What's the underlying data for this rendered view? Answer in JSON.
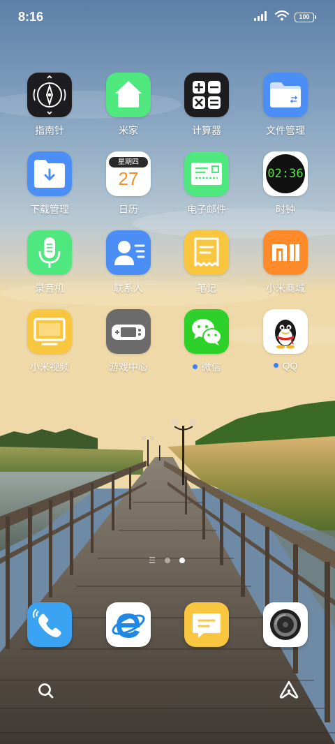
{
  "status_bar": {
    "time": "8:16",
    "battery": "100",
    "signal_icon": "signal-bars-icon",
    "wifi_icon": "wifi-icon"
  },
  "apps": [
    {
      "label": "指南针",
      "icon": "compass-icon"
    },
    {
      "label": "米家",
      "icon": "home-icon"
    },
    {
      "label": "计算器",
      "icon": "calculator-icon"
    },
    {
      "label": "文件管理",
      "icon": "folder-icon"
    },
    {
      "label": "下载管理",
      "icon": "download-folder-icon"
    },
    {
      "label": "日历",
      "icon": "calendar-icon",
      "weekday": "星期四",
      "day": "27"
    },
    {
      "label": "电子邮件",
      "icon": "mail-icon"
    },
    {
      "label": "时钟",
      "icon": "clock-icon",
      "time": "02:36"
    },
    {
      "label": "录音机",
      "icon": "microphone-icon"
    },
    {
      "label": "联系人",
      "icon": "contacts-icon"
    },
    {
      "label": "笔记",
      "icon": "notes-icon"
    },
    {
      "label": "小米商城",
      "icon": "mi-store-icon",
      "logo_text": "MI"
    },
    {
      "label": "小米视频",
      "icon": "tv-icon"
    },
    {
      "label": "游戏中心",
      "icon": "gamepad-icon"
    },
    {
      "label": "微信",
      "icon": "wechat-icon",
      "has_update_dot": true
    },
    {
      "label": "QQ",
      "icon": "qq-penguin-icon",
      "has_update_dot": true
    }
  ],
  "dock": [
    {
      "icon": "phone-icon"
    },
    {
      "icon": "browser-icon"
    },
    {
      "icon": "messages-icon"
    },
    {
      "icon": "camera-icon"
    }
  ],
  "page_indicator": {
    "pages": 2,
    "current": 2
  },
  "bottom_bar": {
    "left_icon": "search-icon",
    "right_icon": "ai-assistant-icon"
  },
  "colors": {
    "dot_blue": "#3f7ef5",
    "home_green": "#4ee87f",
    "files_blue": "#4b8ef5",
    "notes_yellow": "#f9c640",
    "mi_orange": "#ff8a2a",
    "wechat_green": "#2dd12a"
  }
}
